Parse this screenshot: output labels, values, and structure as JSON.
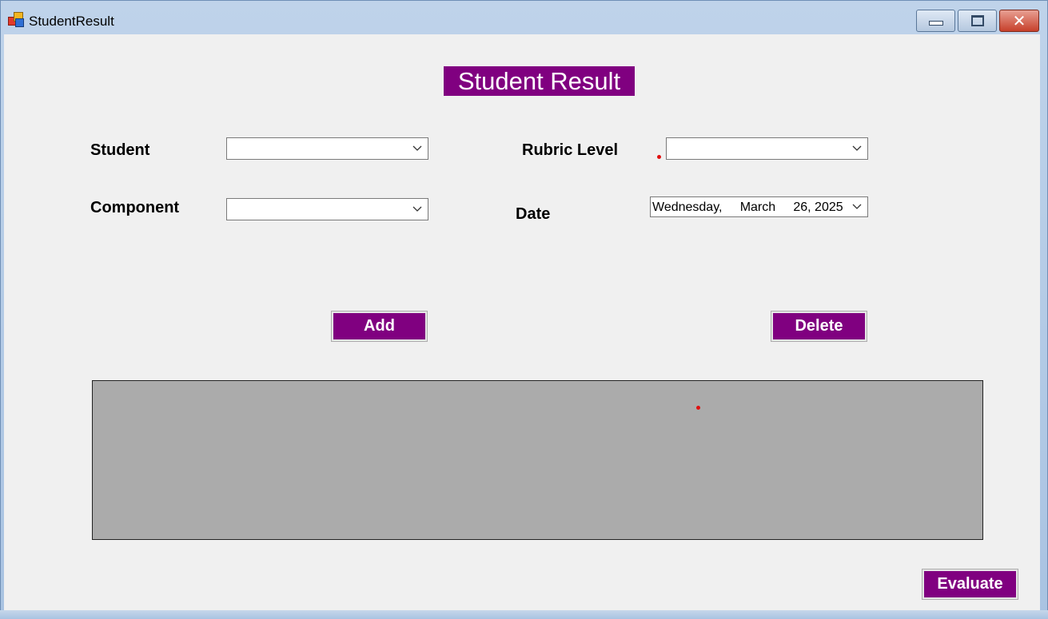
{
  "window": {
    "title": "StudentResult",
    "icon": "app-icon",
    "controls": [
      "minimize-icon",
      "maximize-icon",
      "close-icon"
    ]
  },
  "form": {
    "heading": "Student Result",
    "labels": {
      "student": "Student",
      "component": "Component",
      "rubric_level": "Rubric Level",
      "date": "Date"
    },
    "fields": {
      "student_value": "",
      "component_value": "",
      "rubric_level_value": "",
      "date_value": "Wednesday,     March     26, 2025"
    },
    "buttons": {
      "add": "Add",
      "delete": "Delete",
      "evaluate": "Evaluate"
    }
  },
  "colors": {
    "accent": "#800080",
    "grid_background": "#ababab",
    "form_background": "#f0f0f0"
  }
}
